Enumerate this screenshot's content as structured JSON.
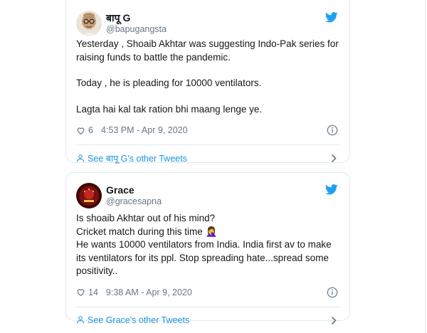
{
  "tweets": [
    {
      "name": "बापू G",
      "handle": "@bapugangsta",
      "paragraphs": [
        "Yesterday , Shoaib Akhtar was suggesting Indo-Pak series for raising funds to battle the pandemic.",
        "Today , he is pleading for 10000 ventilators.",
        "Lagta hai kal tak ration bhi maang lenge ye."
      ],
      "likes": "6",
      "timestamp": "4:53 PM - Apr 9, 2020",
      "see_more": "See बापू G's other Tweets"
    },
    {
      "name": "Grace",
      "handle": "@gracesapna",
      "lines": [
        "Is shoaib Akhtar out of his mind?",
        "Cricket match during this time 🤦‍♀️",
        "He wants 10000 ventilators from India. India first av to make its ventilators for its ppl. Stop spreading hate...spread some positivity.."
      ],
      "likes": "14",
      "timestamp": "9:38 AM - Apr 9, 2020",
      "see_more": "See Grace's other Tweets"
    }
  ],
  "colors": {
    "twitter_blue": "#1da1f2",
    "link_blue": "#1b95e0",
    "muted_gray": "#657786",
    "border": "#e1e8ed"
  },
  "icons": [
    "twitter-bird-icon",
    "heart-icon",
    "info-icon",
    "person-icon",
    "chevron-right-icon"
  ]
}
